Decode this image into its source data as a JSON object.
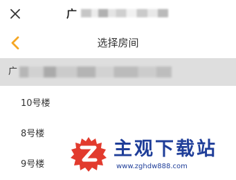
{
  "topbar": {
    "title_prefix": "广",
    "close_icon": "close-icon"
  },
  "header": {
    "title": "选择房间",
    "back_icon": "chevron-left-icon",
    "accent_color": "#f5a623"
  },
  "section": {
    "label_prefix": "广",
    "background": "#dedede"
  },
  "buildings": [
    {
      "label": "10号楼"
    },
    {
      "label": "8号楼"
    },
    {
      "label": "9号楼"
    }
  ],
  "watermark": {
    "title": "主观下载站",
    "url": "www.zghdw888.com",
    "color": "#1f3e99",
    "logo_color": "#e23b2e"
  }
}
